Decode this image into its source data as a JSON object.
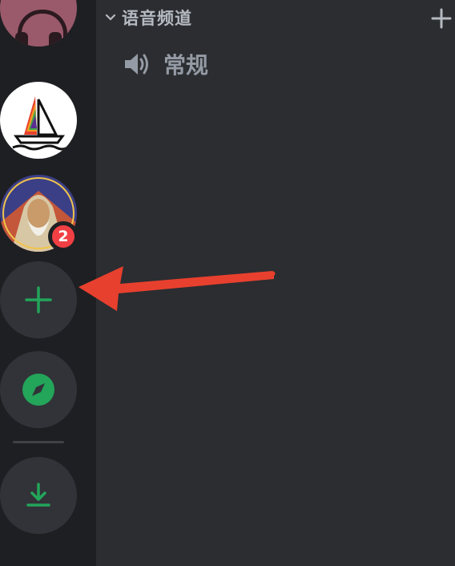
{
  "rail": {
    "servers": [
      {
        "name": "headset-server-icon"
      },
      {
        "name": "sailboat-server-icon"
      },
      {
        "name": "wizard-server-icon",
        "unread_badge": "2"
      }
    ],
    "actions": [
      "add-server",
      "explore-discoverable-servers",
      "download-apps"
    ]
  },
  "sidebar": {
    "category": {
      "label": "语音频道"
    },
    "channels": [
      {
        "type": "voice",
        "label": "常规"
      }
    ]
  },
  "annotation": {
    "arrow_color": "#e8402e",
    "points_to": "add-server"
  },
  "colors": {
    "green": "#23a55a",
    "badge_red": "#f23f43"
  }
}
